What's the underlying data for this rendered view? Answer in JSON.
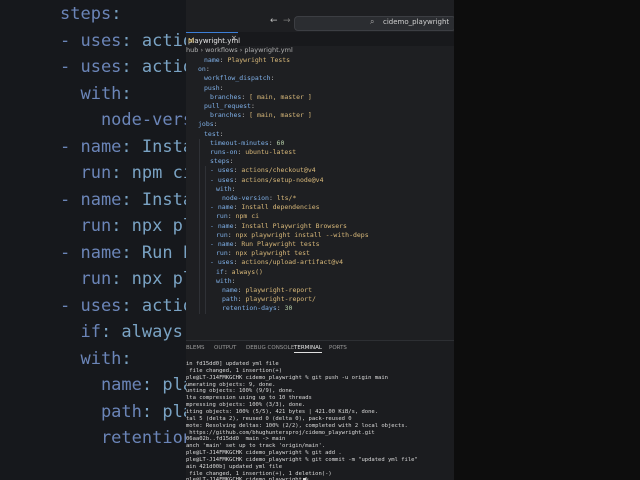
{
  "background_code": [
    {
      "k": "steps",
      "r": ":"
    },
    {
      "k": "- uses",
      "r": ": actions/c"
    },
    {
      "k": "- uses",
      "r": ": actions/s"
    },
    {
      "k": "  with",
      "r": ":"
    },
    {
      "k": "    node-version",
      "r": ":"
    },
    {
      "k": "- name",
      "r": ": Install d"
    },
    {
      "k": "  run",
      "r": ": npm ci"
    },
    {
      "k": "- name",
      "r": ": Install P"
    },
    {
      "k": "  run",
      "r": ": npx playwr"
    },
    {
      "k": "- name",
      "r": ": Run Playw"
    },
    {
      "k": "  run",
      "r": ": npx playwr"
    },
    {
      "k": "- uses",
      "r": ": actions/u"
    },
    {
      "k": "  if",
      "r": ": always()"
    },
    {
      "k": "  with",
      "r": ":"
    },
    {
      "k": "    name",
      "r": ": playwri"
    },
    {
      "k": "    path",
      "r": ": playwri"
    },
    {
      "k": "    retention-day",
      "r": ""
    }
  ],
  "titlebar": {
    "search_label": "cidemo_playwright"
  },
  "tab": {
    "label": "playwright.yml",
    "modified": "M",
    "close": "×"
  },
  "breadcrumb": {
    "items": [
      "hub",
      "workflows",
      "playwright.yml"
    ],
    "sep": "›"
  },
  "code_lines": [
    {
      "i": 1,
      "k": "name",
      "v": "Playwright Tests"
    },
    {
      "i": 0,
      "k": "on",
      "v": ""
    },
    {
      "i": 1,
      "k": "workflow_dispatch",
      "v": ""
    },
    {
      "i": 1,
      "k": "push",
      "v": ""
    },
    {
      "i": 2,
      "k": "branches",
      "v": "[ main, master ]"
    },
    {
      "i": 1,
      "k": "pull_request",
      "v": ""
    },
    {
      "i": 2,
      "k": "branches",
      "v": "[ main, master ]"
    },
    {
      "i": 0,
      "k": "jobs",
      "v": ""
    },
    {
      "i": 1,
      "k": "test",
      "v": ""
    },
    {
      "i": 2,
      "k": "timeout-minutes",
      "v": "60"
    },
    {
      "i": 2,
      "k": "runs-on",
      "v": "ubuntu-latest"
    },
    {
      "i": 2,
      "k": "steps",
      "v": ""
    },
    {
      "i": 2,
      "k": "- uses",
      "v": "actions/checkout@v4"
    },
    {
      "i": 2,
      "k": "- uses",
      "v": "actions/setup-node@v4"
    },
    {
      "i": 3,
      "k": "with",
      "v": ""
    },
    {
      "i": 4,
      "k": "node-version",
      "v": "lts/*"
    },
    {
      "i": 2,
      "k": "- name",
      "v": "Install dependencies"
    },
    {
      "i": 3,
      "k": "run",
      "v": "npm ci"
    },
    {
      "i": 2,
      "k": "- name",
      "v": "Install Playwright Browsers"
    },
    {
      "i": 3,
      "k": "run",
      "v": "npx playwright install --with-deps"
    },
    {
      "i": 2,
      "k": "- name",
      "v": "Run Playwright tests"
    },
    {
      "i": 3,
      "k": "run",
      "v": "npx playwright test"
    },
    {
      "i": 2,
      "k": "- uses",
      "v": "actions/upload-artifact@v4"
    },
    {
      "i": 3,
      "k": "if",
      "v": "always()"
    },
    {
      "i": 3,
      "k": "with",
      "v": ""
    },
    {
      "i": 4,
      "k": "name",
      "v": "playwright-report"
    },
    {
      "i": 4,
      "k": "path",
      "v": "playwright-report/"
    },
    {
      "i": 4,
      "k": "retention-days",
      "v": "30"
    }
  ],
  "panel_tabs": [
    {
      "label": "BLEMS",
      "active": false
    },
    {
      "label": "OUTPUT",
      "active": false
    },
    {
      "label": "DEBUG CONSOLE",
      "active": false
    },
    {
      "label": "TERMINAL",
      "active": true
    },
    {
      "label": "PORTS",
      "active": false
    }
  ],
  "terminal_lines": [
    "in fd15dd0] updated yml file",
    " file changed, 1 insertion(+)",
    "ple@LT-J14FMKGCHK cidemo_playwright % git push -u origin main",
    "umerating objects: 9, done.",
    "unting objects: 100% (9/9), done.",
    "lta compression using up to 10 threads",
    "mpressing objects: 100% (3/3), done.",
    "iting objects: 100% (5/5), 421 bytes | 421.00 KiB/s, done.",
    "tal 5 (delta 2), reused 0 (delta 0), pack-reused 0",
    "mote: Resolving deltas: 100% (2/2), completed with 2 local objects.",
    " https://github.com/bhughuntersproj/cidemo_playwright.git",
    "06aa02b..fd15dd0  main -> main",
    "anch 'main' set up to track 'origin/main'.",
    "ple@LT-J14FMKGCHK cidemo_playwright % git add .",
    "ple@LT-J14FMKGCHK cidemo_playwright % git commit -m \"updated yml file\"",
    "ain 421d00b] updated yml file",
    " file changed, 1 insertion(+), 1 deletion(-)",
    "ple@LT-J14FMKGCHK cidemo_playwright % "
  ]
}
